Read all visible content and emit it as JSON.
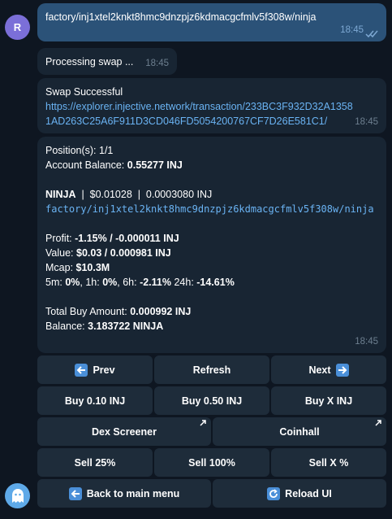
{
  "user": {
    "avatar_letter": "R"
  },
  "messages": {
    "outgoing": {
      "text": "factory/inj1xtel2knkt8hmc9dnzpjz6kdmacgcfmlv5f308w/ninja",
      "time": "18:45"
    },
    "processing": {
      "text": "Processing swap ...",
      "time": "18:45"
    },
    "success": {
      "title": "Swap Successful",
      "link": "https://explorer.injective.network/transaction/233BC3F932D32A13581AD263C25A6F911D3CD046FD5054200767CF7D26E581C1/",
      "time": "18:45"
    },
    "info": {
      "positions_label": "Position(s): 1/1",
      "balance_label": "Account Balance: ",
      "balance_value": "0.55277 INJ",
      "token_name": "NINJA",
      "token_prices": "  |  $0.01028  |  0.0003080 INJ",
      "token_denom": "factory/inj1xtel2knkt8hmc9dnzpjz6kdmacgcfmlv5f308w/ninja",
      "profit_label": "Profit: ",
      "profit_value": "-1.15% / -0.000011 INJ",
      "value_label": "Value: ",
      "value_value": "$0.03 / 0.000981 INJ",
      "mcap_label": "Mcap: ",
      "mcap_value": "$10.3M",
      "changes": {
        "m5_label": "5m: ",
        "m5_value": "0%",
        "h1_label": ", 1h: ",
        "h1_value": "0%",
        "h6_label": ", 6h: ",
        "h6_value": "-2.11%",
        "h24_label": " 24h: ",
        "h24_value": "-14.61%"
      },
      "total_buy_label": "Total Buy Amount: ",
      "total_buy_value": "0.000992 INJ",
      "token_balance_label": "Balance: ",
      "token_balance_value": "3.183722 NINJA",
      "time": "18:45"
    }
  },
  "keyboard": {
    "prev": "Prev",
    "refresh": "Refresh",
    "next": "Next",
    "buy_010": "Buy 0.10 INJ",
    "buy_050": "Buy 0.50 INJ",
    "buy_x": "Buy X INJ",
    "dex_screener": "Dex Screener",
    "coinhall": "Coinhall",
    "sell_25": "Sell 25%",
    "sell_100": "Sell 100%",
    "sell_x": "Sell X %",
    "back_main": "Back to main menu",
    "reload_ui": "Reload UI"
  },
  "colors": {
    "background": "#0e1621",
    "outgoing_bubble": "#2b5278",
    "incoming_bubble": "#182533",
    "button": "#1e2c3a",
    "link": "#6ab3f3",
    "emoji_box": "#4a8fd8"
  },
  "icons": {
    "prev_button": "left-arrow-emoji-icon",
    "next_button": "right-arrow-emoji-icon",
    "back_button": "left-arrow-emoji-icon",
    "reload_button": "reload-emoji-icon",
    "external": "external-link-arrow-icon",
    "read_status": "double-check-icon",
    "bot_avatar": "ghost-icon"
  }
}
